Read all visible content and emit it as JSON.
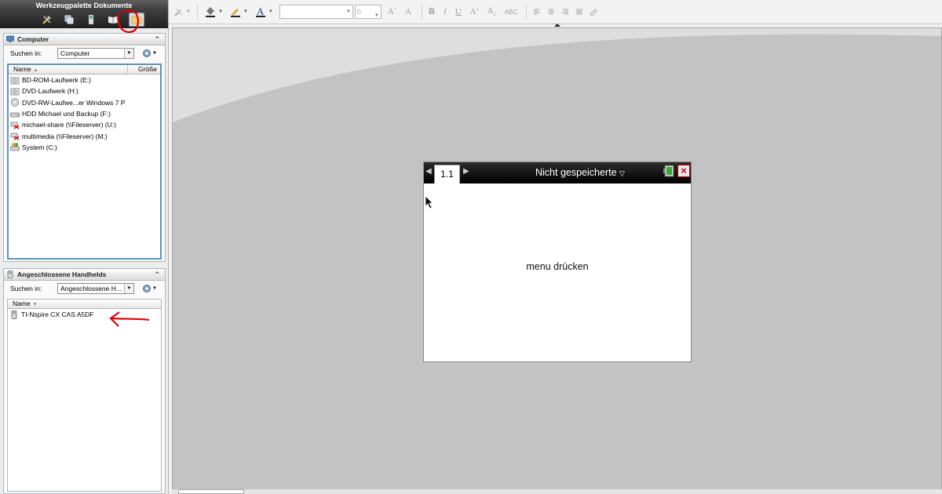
{
  "palette": {
    "title": "Werkzeugpalette Dokumente",
    "buttons": [
      "tools-icon",
      "pages-icon",
      "handheld-icon",
      "book-icon",
      "folder-icon"
    ]
  },
  "computer_panel": {
    "title": "Computer",
    "search_label": "Suchen in:",
    "search_value": "Computer",
    "col_name": "Name",
    "col_size": "Größe",
    "items": [
      {
        "label": "BD-ROM-Laufwerk (E:)",
        "icon": "optical-drive-icon"
      },
      {
        "label": "DVD-Laufwerk (H:)",
        "icon": "optical-drive-icon"
      },
      {
        "label": "DVD-RW-Laufwe...er Windows 7 P",
        "icon": "disc-icon"
      },
      {
        "label": "HDD Michael und Backup (F:)",
        "icon": "hard-drive-icon"
      },
      {
        "label": "michael-share (\\\\Fileserver) (U:)",
        "icon": "network-drive-disconnected-icon"
      },
      {
        "label": "multimedia (\\\\Fileserver) (M:)",
        "icon": "network-drive-disconnected-icon"
      },
      {
        "label": "System (C:)",
        "icon": "system-drive-icon"
      }
    ]
  },
  "handhelds_panel": {
    "title": "Angeschlossene Handhelds",
    "search_label": "Suchen in:",
    "search_value": "Angeschlossene H...",
    "col_name": "Name",
    "items": [
      {
        "label": "TI-Nspire CX CAS A5DF",
        "icon": "calculator-icon"
      }
    ]
  },
  "toolbar": {
    "font_value": "",
    "size_value": "0",
    "format_labels": [
      "B",
      "I",
      "U",
      "A",
      "A",
      "ABC"
    ]
  },
  "handheld": {
    "tab_label": "1.1",
    "doc_title": "Nicht gespeicherte",
    "message": "menu drücken"
  },
  "colors": {
    "annotation_red": "#e00000",
    "list_border": "#5b94b7",
    "canvas_bg": "#c3c3c3"
  }
}
